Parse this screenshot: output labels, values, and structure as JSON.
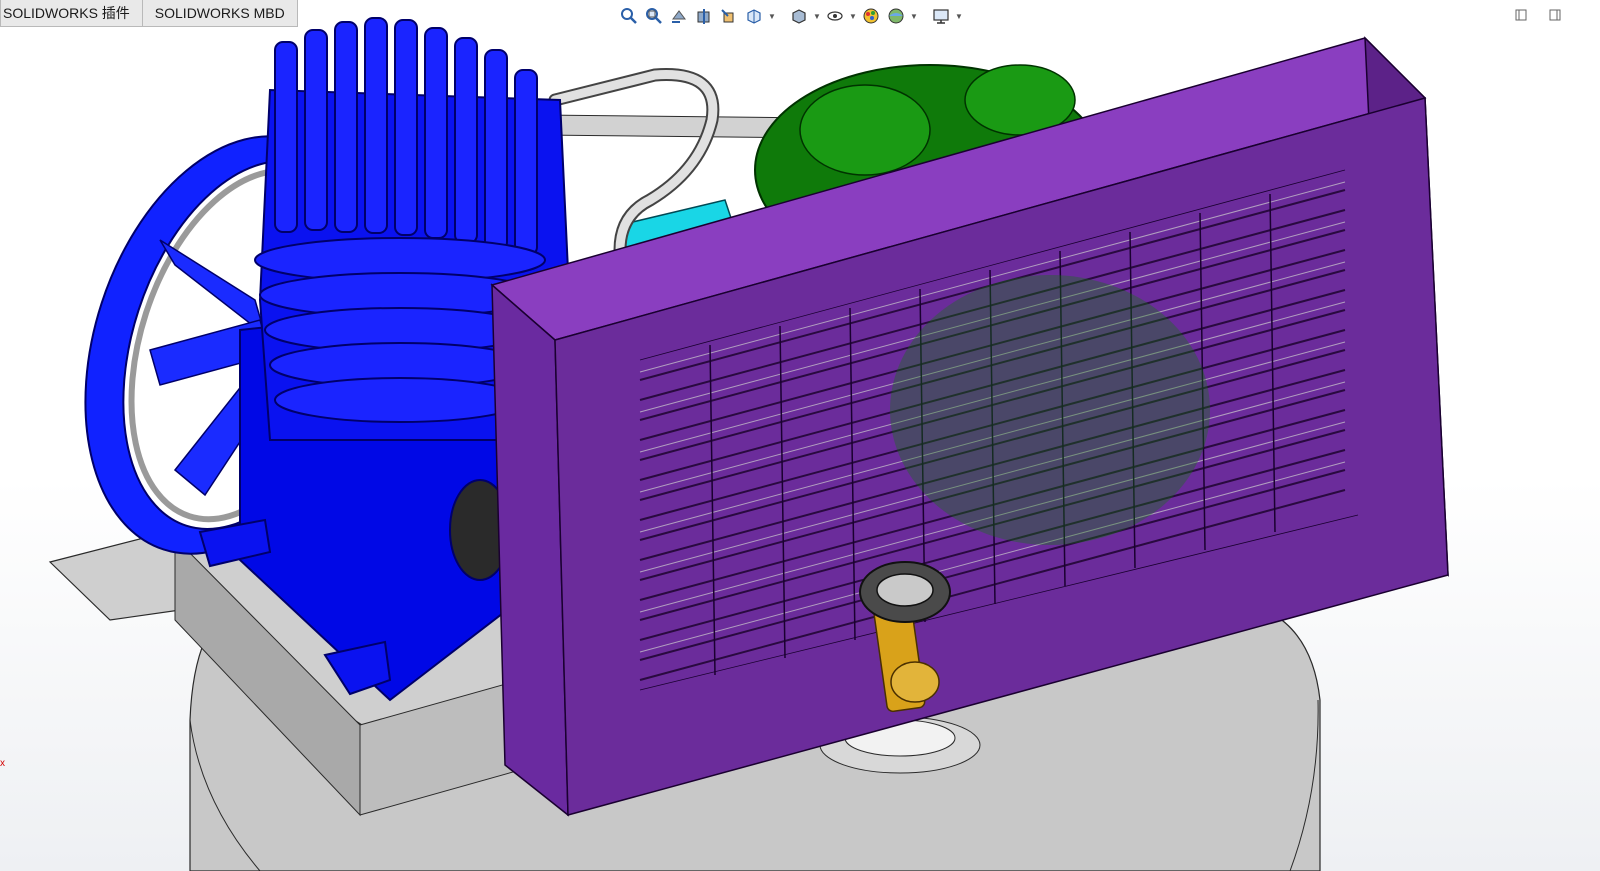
{
  "tabs": [
    {
      "label": "SOLIDWORKS 插件"
    },
    {
      "label": "SOLIDWORKS MBD"
    }
  ],
  "heads_up_toolbar": [
    {
      "icon": "zoom-to-fit-icon"
    },
    {
      "icon": "zoom-to-area-icon"
    },
    {
      "icon": "previous-view-icon"
    },
    {
      "icon": "section-view-icon"
    },
    {
      "icon": "dynamic-annotation-views-icon"
    },
    {
      "icon": "view-orientation-icon",
      "dropdown": true
    },
    {
      "icon": "display-style-icon",
      "dropdown": true
    },
    {
      "icon": "hide-show-items-icon",
      "dropdown": true
    },
    {
      "icon": "edit-appearance-icon"
    },
    {
      "icon": "apply-scene-icon",
      "dropdown": true
    },
    {
      "icon": "view-settings-icon",
      "dropdown": true
    }
  ],
  "window_controls": [
    {
      "icon": "restore-panel-icon"
    },
    {
      "icon": "maximize-panel-icon"
    }
  ],
  "model": {
    "name": "air compressor assembly",
    "colors": {
      "pump_head": "#0a12f0",
      "flywheel": "#1a2bff",
      "motor": "#0f7a0a",
      "fan_guard": "#6a2c9a",
      "tank": "#c9c9c9",
      "pipe": "#dcdcdc",
      "valve": "#d9a21a",
      "coupling": "#19d6e6"
    }
  },
  "triad": {
    "label": "x"
  }
}
